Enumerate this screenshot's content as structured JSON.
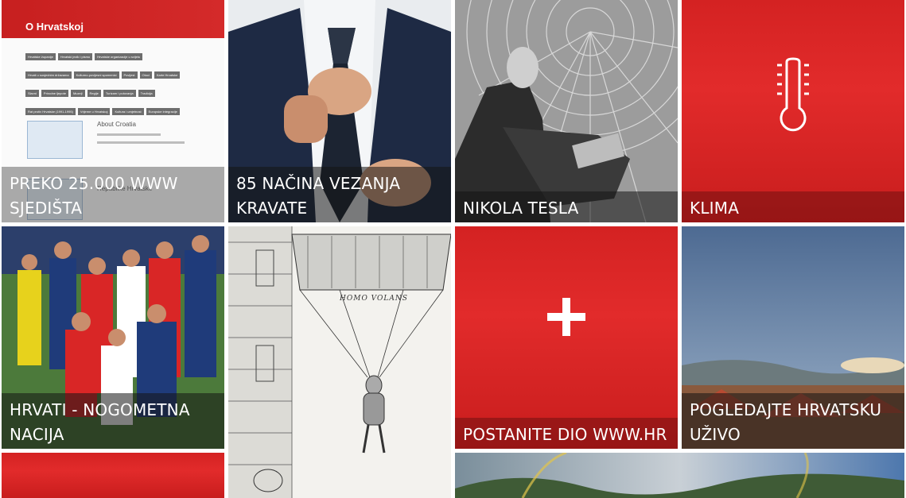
{
  "tiles": [
    {
      "caption": "PREKO 25.000 WWW SJEDIŠTA",
      "preview": {
        "header": "O Hrvatskoj",
        "tags": [
          "Hrvatske županije",
          "Hrvatski jezik i pismo",
          "Hrvatske organizacije u svijetu",
          "Hrvati u susjednim državama",
          "Kulturno-povijesni spomenici",
          "Povijest",
          "Otoci",
          "Karte Hrvatske",
          "Slavni",
          "Prirodne ljepote",
          "Muzeji",
          "Regije",
          "Turizam i putovanja",
          "Tradicija",
          "Rat protiv Hrvatske (1991-1995)",
          "Vrijeme u Hrvatskoj",
          "Kultura i umjetnost",
          "Europske integracije"
        ],
        "title1": "About Croatia",
        "title2": "Republike Hrvatske"
      }
    },
    {
      "caption": "85 NAČINA VEZANJA KRAVATE"
    },
    {
      "caption": "NIKOLA TESLA"
    },
    {
      "caption": "KLIMA",
      "icon": "thermometer-icon"
    },
    {
      "caption": "HRVATI - NOGOMETNA NACIJA"
    },
    {
      "caption": "",
      "engraving_text": "HOMO VOLANS"
    },
    {
      "caption": "POSTANITE DIO WWW.HR",
      "icon": "plus-icon"
    },
    {
      "caption": "POGLEDAJTE HRVATSKU UŽIVO"
    }
  ],
  "colors": {
    "brand_red": "#d42222",
    "caption_overlay": "rgba(20,20,20,0.55)"
  }
}
